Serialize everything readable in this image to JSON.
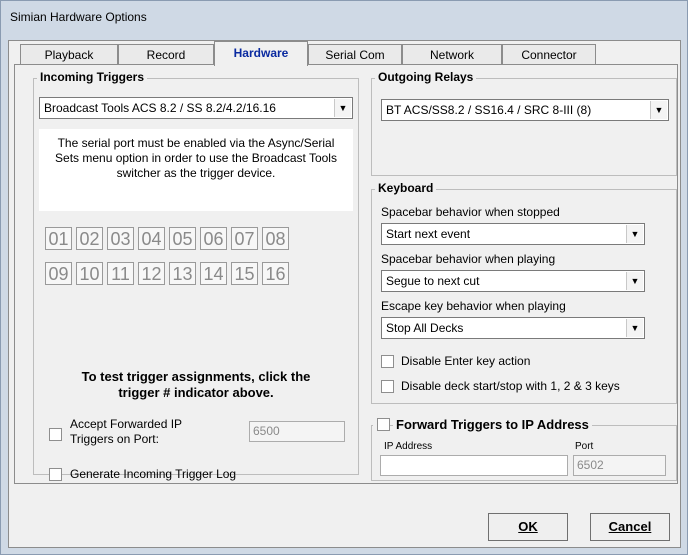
{
  "window": {
    "title": "Simian Hardware Options"
  },
  "tabs": [
    "Playback",
    "Record",
    "Hardware",
    "Serial Com",
    "Network",
    "Connector"
  ],
  "incoming": {
    "title": "Incoming Triggers",
    "device": "Broadcast Tools ACS 8.2 / SS 8.2/4.2/16.16",
    "note": "The serial port must be enabled via the Async/Serial Sets menu option in order to use the Broadcast Tools switcher as the trigger device.",
    "triggers": [
      "01",
      "02",
      "03",
      "04",
      "05",
      "06",
      "07",
      "08",
      "09",
      "10",
      "11",
      "12",
      "13",
      "14",
      "15",
      "16"
    ],
    "test_hint_line1": "To test trigger assignments, click the",
    "test_hint_line2": "trigger # indicator above.",
    "accept_label_line1": "Accept Forwarded IP",
    "accept_label_line2": "Triggers on Port:",
    "accept_checked": false,
    "accept_port": "6500",
    "log_label": "Generate Incoming Trigger Log",
    "log_checked": false
  },
  "outgoing": {
    "title": "Outgoing Relays",
    "device": "BT ACS/SS8.2 / SS16.4 / SRC 8-III (8)"
  },
  "keyboard": {
    "title": "Keyboard",
    "stopped_label": "Spacebar behavior when stopped",
    "stopped_value": "Start next event",
    "playing_label": "Spacebar behavior when playing",
    "playing_value": "Segue to next cut",
    "escape_label": "Escape key behavior when playing",
    "escape_value": "Stop All Decks",
    "disable_enter": "Disable Enter key action",
    "disable_deck": "Disable deck start/stop with 1, 2 & 3 keys"
  },
  "forward": {
    "title": "Forward Triggers to IP Address",
    "checked": false,
    "ip_label": "IP Address",
    "ip_value": "",
    "port_label": "Port",
    "port_value": "6502"
  },
  "buttons": {
    "ok": "OK",
    "cancel": "Cancel"
  },
  "icons": {
    "dropdown": "chevron-down-icon",
    "checkbox": "checkbox-icon"
  }
}
